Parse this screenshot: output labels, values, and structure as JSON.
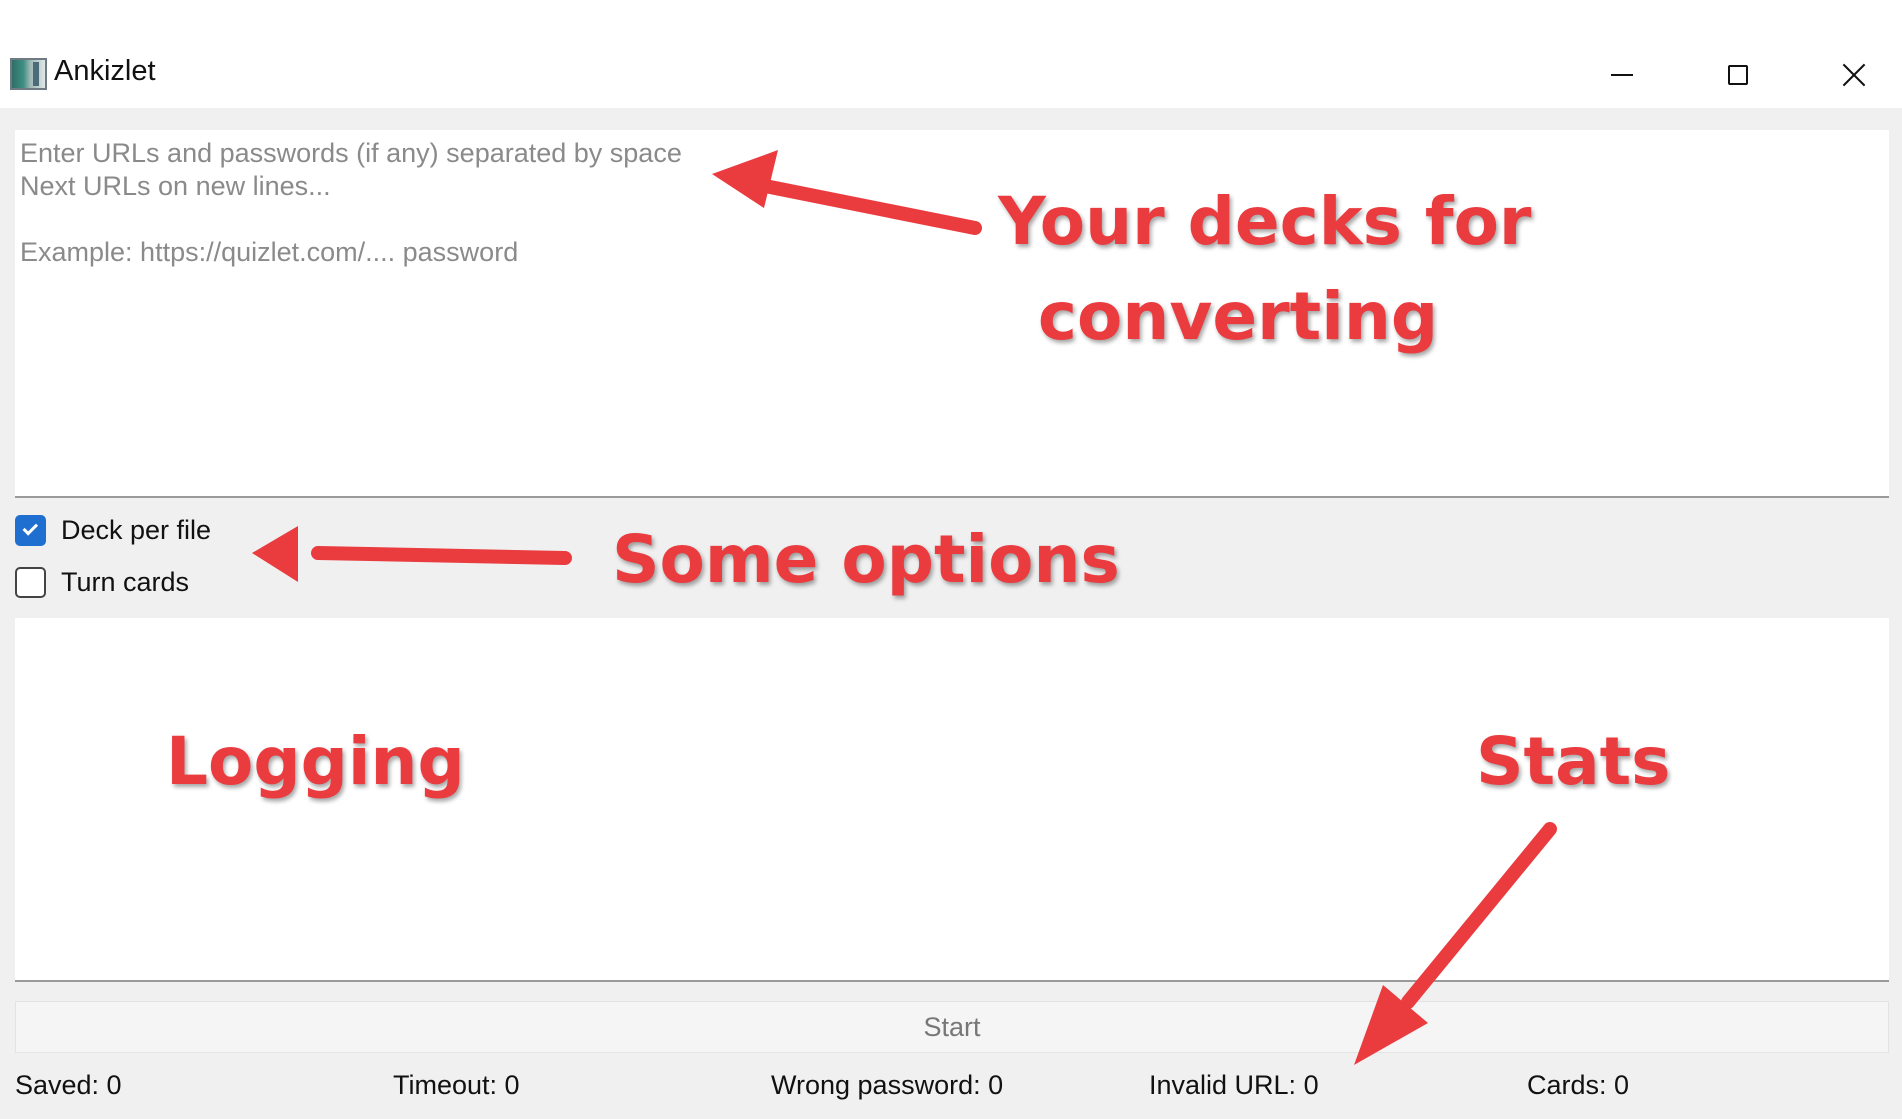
{
  "window": {
    "title": "Ankizlet",
    "controls": {
      "minimize": "minimize",
      "maximize": "maximize",
      "close": "close"
    }
  },
  "input": {
    "placeholder": "Enter URLs and passwords (if any) separated by space\nNext URLs on new lines...\n\nExample: https://quizlet.com/.... password",
    "value": ""
  },
  "options": [
    {
      "label": "Deck per file",
      "checked": true
    },
    {
      "label": "Turn cards",
      "checked": false
    }
  ],
  "log": {
    "text": ""
  },
  "start_button": {
    "label": "Start",
    "enabled": false
  },
  "stats": {
    "saved": "Saved: 0",
    "timeout": "Timeout: 0",
    "wrong_password": "Wrong password: 0",
    "invalid_url": "Invalid URL: 0",
    "cards": "Cards: 0"
  },
  "annotations": {
    "decks_line1": "Your decks for",
    "decks_line2": "converting",
    "options": "Some options",
    "logging": "Logging",
    "stats": "Stats",
    "color": "#ea3b3f"
  }
}
